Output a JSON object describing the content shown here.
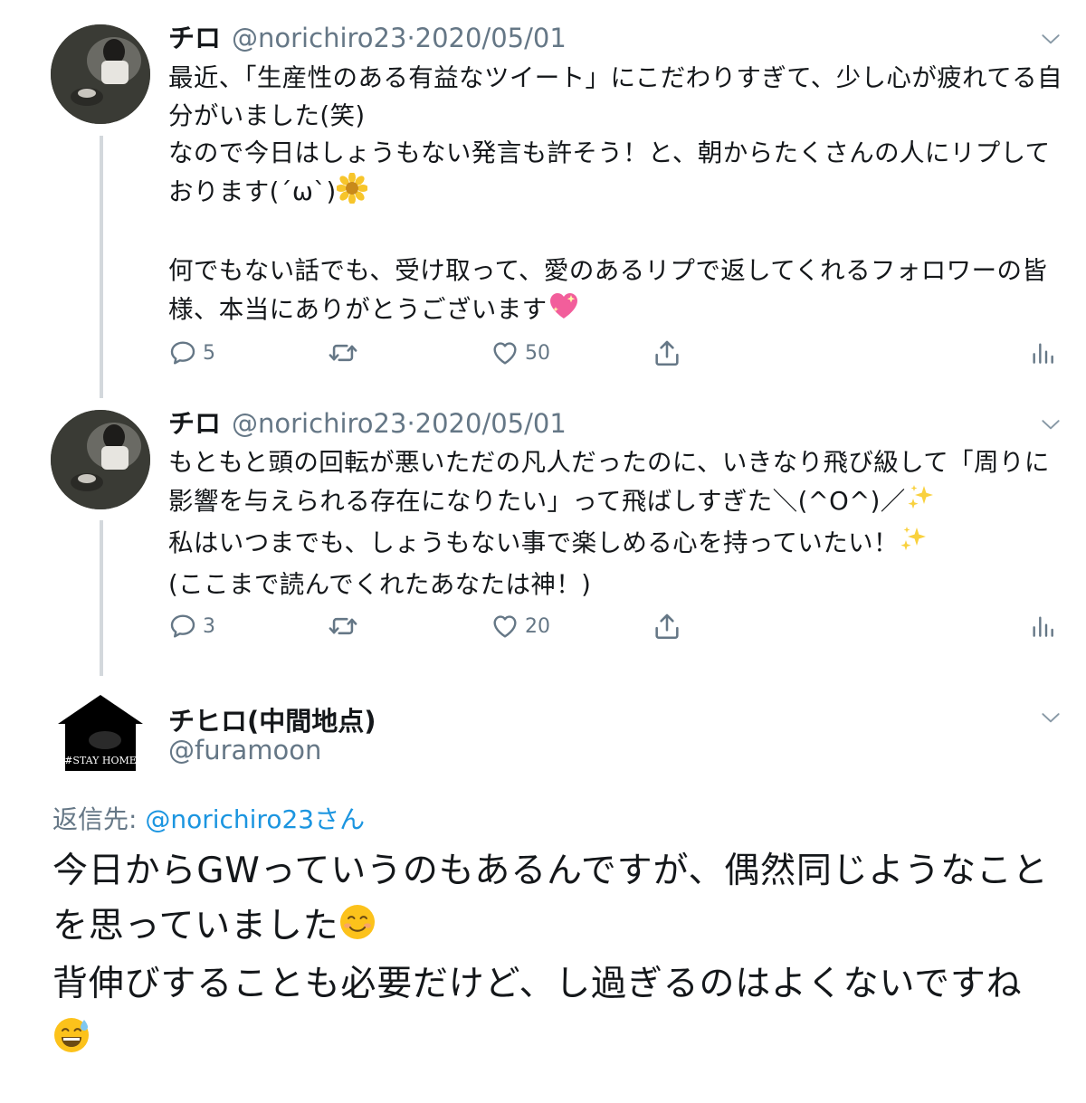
{
  "tweets": [
    {
      "name": "チロ",
      "handle": "@norichiro23",
      "separator": "·",
      "date": "2020/05/01",
      "text": "最近、「生産性のある有益なツイート」にこだわりすぎて、少し心が疲れてる自分がいました(笑)\nなので今日はしょうもない発言も許そう！と、朝からたくさんの人にリプしております(´ω`)",
      "text2": "\n\n何でもない話でも、受け取って、愛のあるリプで返してくれるフォロワーの皆様、本当にありがとうございます",
      "emoji1": "sunflower",
      "emoji2": "sparkling-heart",
      "replies": "5",
      "retweets": "",
      "likes": "50"
    },
    {
      "name": "チロ",
      "handle": "@norichiro23",
      "separator": "·",
      "date": "2020/05/01",
      "text_a": "もともと頭の回転が悪いただの凡人だったのに、いきなり飛び級して「周りに影響を与えられる存在になりたい」って飛ばしすぎた＼(^O^)／",
      "text_b": "\n私はいつまでも、しょうもない事で楽しめる心を持っていたい！",
      "text_c": "\n(ここまで読んでくれたあなたは神！)",
      "emoji": "sparkles",
      "replies": "3",
      "retweets": "",
      "likes": "20"
    }
  ],
  "reply": {
    "name": "チヒロ(中間地点)",
    "handle": "@furamoon",
    "avatar_caption": "#STAY HOME",
    "reply_prefix": "返信先: ",
    "reply_mention": "@norichiro23さん",
    "text_a": "今日からGWっていうのもあるんですが、偶然同じようなことを思っていました",
    "text_b": "\n背伸びすることも必要だけど、し過ぎるのはよくないですね\n",
    "emoji_a": "smiling-face",
    "emoji_b": "grinning-sweat-face"
  },
  "icons": {
    "reply": "reply-icon",
    "retweet": "retweet-icon",
    "like": "heart-icon",
    "share": "share-icon",
    "analytics": "analytics-icon",
    "more": "chevron-down-icon"
  },
  "colors": {
    "secondary_text": "#657786",
    "link": "#1b95e0",
    "thread_line": "#d3d8dc"
  }
}
